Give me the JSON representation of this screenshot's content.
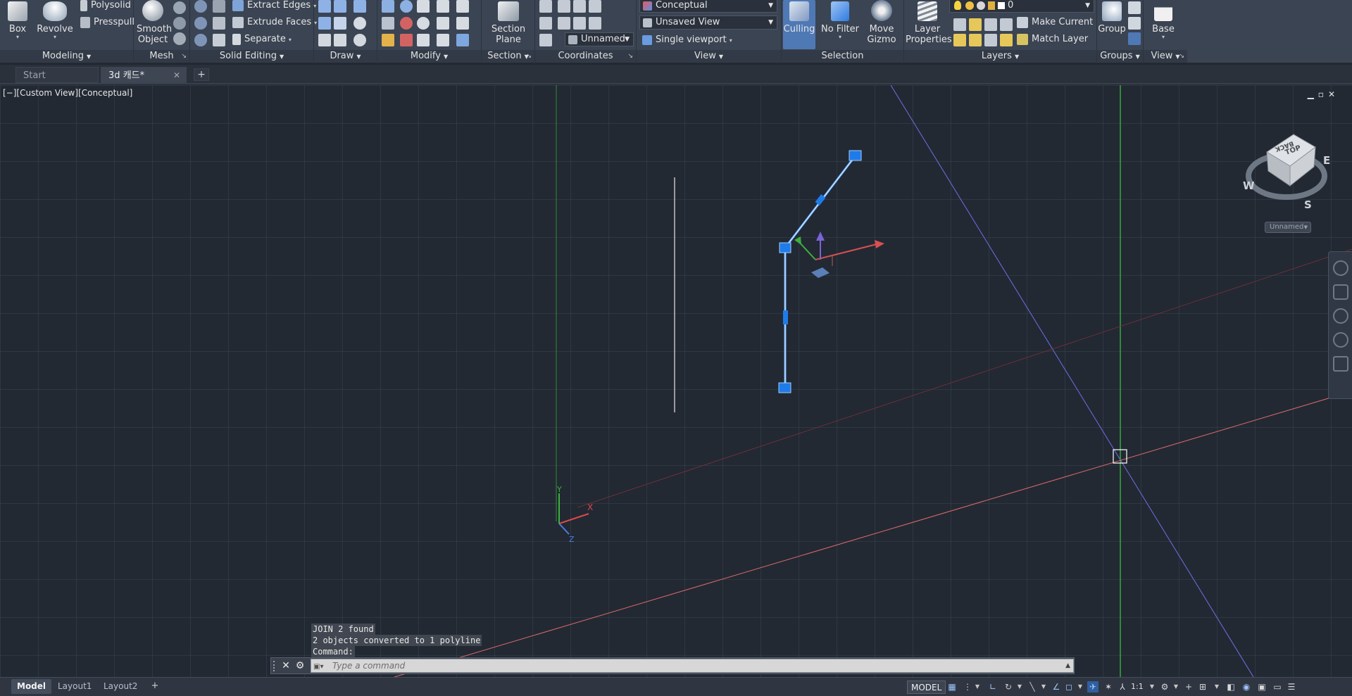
{
  "ribbon": {
    "panels": {
      "modeling": "Modeling",
      "mesh": "Mesh",
      "solid_editing": "Solid Editing",
      "draw": "Draw",
      "modify": "Modify",
      "section": "Section",
      "coordinates": "Coordinates",
      "view": "View",
      "selection": "Selection",
      "layers": "Layers",
      "groups": "Groups",
      "view2": "View"
    },
    "buttons": {
      "box": "Box",
      "revolve": "Revolve",
      "polysolid": "Polysolid",
      "presspull": "Presspull",
      "smooth_object_1": "Smooth",
      "smooth_object_2": "Object",
      "extract_edges": "Extract Edges",
      "extrude_faces": "Extrude Faces",
      "separate": "Separate",
      "section_plane_1": "Section",
      "section_plane_2": "Plane",
      "culling": "Culling",
      "no_filter": "No Filter",
      "move_gizmo_1": "Move",
      "move_gizmo_2": "Gizmo",
      "layer_properties_1": "Layer",
      "layer_properties_2": "Properties",
      "make_current": "Make Current",
      "match_layer": "Match Layer",
      "group": "Group",
      "base": "Base",
      "single_viewport": "Single viewport"
    },
    "combos": {
      "visual_style": "Conceptual",
      "named_view": "Unsaved View",
      "ucs": "Unnamed",
      "layer": "0"
    }
  },
  "file_tabs": [
    {
      "label": "Start",
      "active": false
    },
    {
      "label": "3d 캐드*",
      "active": true
    }
  ],
  "viewport": {
    "label": "[−][Custom View][Conceptual]",
    "viewcube": {
      "top": "TOP",
      "back": "BACK",
      "north": "",
      "east": "E",
      "south": "S",
      "west": "W",
      "ucs_label": "Unnamed"
    },
    "axis_labels": {
      "x": "X",
      "y": "Y",
      "z": "Z"
    }
  },
  "command": {
    "history": [
      "JOIN 2 found",
      "2 objects converted to 1 polyline",
      "Command:"
    ],
    "placeholder": "Type a command"
  },
  "layout_tabs": [
    {
      "label": "Model",
      "active": true
    },
    {
      "label": "Layout1",
      "active": false
    },
    {
      "label": "Layout2",
      "active": false
    }
  ],
  "status": {
    "space": "MODEL",
    "scale": "1:1"
  },
  "colors": {
    "ribbon_bg": "#3b4453",
    "viewport_bg": "#222933",
    "selected_blue": "#1f7be8",
    "axis_red": "#e05a5a",
    "axis_green": "#4bcf4b",
    "axis_blue": "#6a6cf0"
  }
}
